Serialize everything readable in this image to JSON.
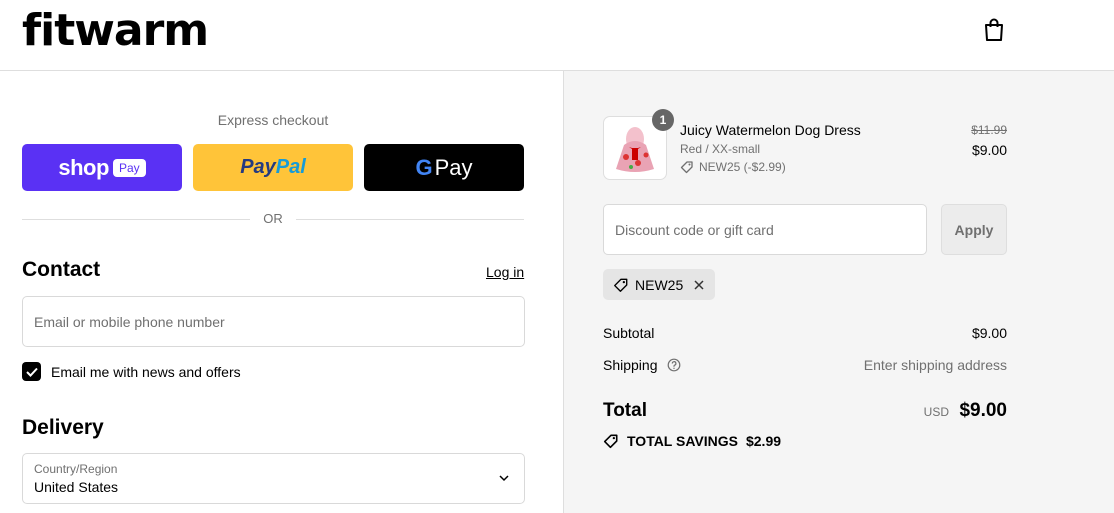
{
  "header": {
    "logo": "fitwarm",
    "cart_icon": "shopping-bag-icon"
  },
  "express": {
    "title": "Express checkout",
    "shop_pay": {
      "brand": "shop",
      "badge": "Pay"
    },
    "paypal": {
      "part1": "Pay",
      "part2": "Pal"
    },
    "gpay": {
      "g": "G",
      "label": "Pay"
    },
    "or_label": "OR"
  },
  "contact": {
    "title": "Contact",
    "login_label": "Log in",
    "email_placeholder": "Email or mobile phone number",
    "newsletter_label": "Email me with news and offers",
    "newsletter_checked": true
  },
  "delivery": {
    "title": "Delivery",
    "country_label": "Country/Region",
    "country_value": "United States"
  },
  "summary": {
    "item": {
      "quantity": "1",
      "name": "Juicy Watermelon Dog Dress",
      "variant": "Red / XX-small",
      "discount": "NEW25 (-$2.99)",
      "original_price": "$11.99",
      "price": "$9.00"
    },
    "discount_placeholder": "Discount code or gift card",
    "apply_label": "Apply",
    "applied_code": "NEW25",
    "subtotal_label": "Subtotal",
    "subtotal_value": "$9.00",
    "shipping_label": "Shipping",
    "shipping_value": "Enter shipping address",
    "total_label": "Total",
    "currency": "USD",
    "total_value": "$9.00",
    "savings_label": "TOTAL SAVINGS",
    "savings_value": "$2.99"
  },
  "colors": {
    "shop_pay": "#5a31f4",
    "paypal": "#ffc439",
    "gpay": "#000000",
    "summary_bg": "#f5f5f5"
  }
}
